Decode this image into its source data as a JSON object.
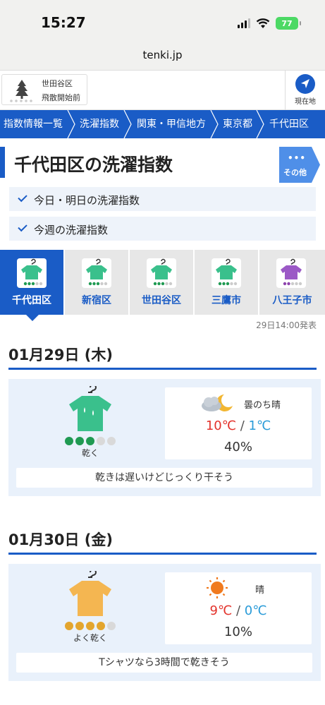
{
  "status": {
    "time": "15:27",
    "battery": "77"
  },
  "browser": {
    "url": "tenki.jp"
  },
  "location": {
    "area": "世田谷区",
    "pollen_status": "飛散開始前",
    "current_location": "現在地"
  },
  "breadcrumb": [
    "指数情報一覧",
    "洗濯指数",
    "関東・甲信地方",
    "東京都",
    "千代田区"
  ],
  "page": {
    "title": "千代田区の洗濯指数",
    "more_dots": "•••",
    "more_label": "その他"
  },
  "links": {
    "today_tomorrow": "今日・明日の洗濯指数",
    "week": "今週の洗濯指数"
  },
  "tabs": [
    {
      "label": "千代田区",
      "active": true
    },
    {
      "label": "新宿区",
      "active": false
    },
    {
      "label": "世田谷区",
      "active": false
    },
    {
      "label": "三鷹市",
      "active": false
    },
    {
      "label": "八王子市",
      "active": false
    }
  ],
  "issued": "29日14:00発表",
  "days": [
    {
      "date": "01月29日 (木)",
      "level": 3,
      "level_max": 5,
      "level_label": "乾く",
      "shirt_color": "#3ac08c",
      "dot_color": "#1f9a52",
      "weather": "曇のち晴",
      "weather_icon": "cloud-moon-icon",
      "high": "10℃",
      "low": "1℃",
      "precip": "40%",
      "comment": "乾きは遅いけどじっくり干そう"
    },
    {
      "date": "01月30日 (金)",
      "level": 4,
      "level_max": 5,
      "level_label": "よく乾く",
      "shirt_color": "#f4b651",
      "dot_color": "#e3a52e",
      "weather": "晴",
      "weather_icon": "sun-icon",
      "high": "9℃",
      "low": "0℃",
      "precip": "10%",
      "comment": "Tシャツなら3時間で乾きそう"
    }
  ],
  "temp_separator": "/"
}
